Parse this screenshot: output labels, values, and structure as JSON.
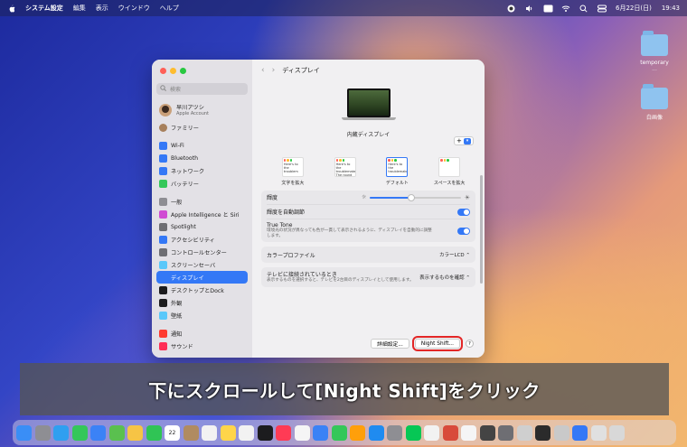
{
  "menubar": {
    "app_name": "システム設定",
    "menus": [
      "編集",
      "表示",
      "ウインドウ",
      "ヘルプ"
    ],
    "datetime": "6月22日(日)",
    "time": "19:43"
  },
  "desktop": {
    "icons": [
      {
        "label": "temporary",
        "sublabel": "..."
      },
      {
        "label": "白画像"
      }
    ]
  },
  "sidebar": {
    "search_placeholder": "検索",
    "account": {
      "name": "早川アツシ",
      "sub": "Apple Account"
    },
    "family": "ファミリー",
    "group1": [
      {
        "label": "Wi-Fi",
        "color": "#3478f6"
      },
      {
        "label": "Bluetooth",
        "color": "#3478f6"
      },
      {
        "label": "ネットワーク",
        "color": "#3478f6"
      },
      {
        "label": "バッテリー",
        "color": "#34c759"
      }
    ],
    "group2": [
      {
        "label": "一般",
        "color": "#8e8e93"
      },
      {
        "label": "Apple Intelligence と Siri",
        "color": "#d04bd3"
      },
      {
        "label": "Spotlight",
        "color": "#6e6e73"
      },
      {
        "label": "アクセシビリティ",
        "color": "#3478f6"
      },
      {
        "label": "コントロールセンター",
        "color": "#6e6e73"
      },
      {
        "label": "スクリーンセーバ",
        "color": "#5ac8fa"
      },
      {
        "label": "ディスプレイ",
        "color": "#3478f6",
        "selected": true
      },
      {
        "label": "デスクトップとDock",
        "color": "#1c1c1e"
      },
      {
        "label": "外観",
        "color": "#1c1c1e"
      },
      {
        "label": "壁紙",
        "color": "#5ac8fa"
      }
    ],
    "group3": [
      {
        "label": "通知",
        "color": "#ff3b30"
      },
      {
        "label": "サウンド",
        "color": "#ff2d55"
      }
    ]
  },
  "content": {
    "title": "ディスプレイ",
    "display_name": "内蔵ディスプレイ",
    "add_label": "+",
    "resolutions": [
      {
        "label": "文字を拡大",
        "text": "Here's to the troublem"
      },
      {
        "label": "",
        "text": "Here's to the troublemakers. The round pegs"
      },
      {
        "label": "デフォルト",
        "text": "Here's to the troublemakers",
        "selected": true
      },
      {
        "label": "スペースを拡大",
        "text": ""
      }
    ],
    "brightness_label": "輝度",
    "brightness_level": 0.45,
    "auto_brightness_label": "輝度を自動調節",
    "true_tone_label": "True Tone",
    "true_tone_desc": "環境光の状況が異なっても色が一貫して表示されるように、ディスプレイを自動的に調整します。",
    "color_profile_label": "カラープロファイル",
    "color_profile_value": "カラーLCD",
    "tv_label": "テレビに接続されているとき",
    "tv_desc": "表示するものを選択すると、テレビを2台目のディスプレイとして使用します。",
    "tv_value": "表示するものを確認",
    "advanced_button": "詳細設定...",
    "night_shift_button": "Night Shift...",
    "help": "?"
  },
  "caption": "下にスクロールして[Night Shift]をクリック",
  "dock": {
    "apps": [
      {
        "name": "finder",
        "color": "#3a8ef6"
      },
      {
        "name": "launchpad",
        "color": "#8e8e93"
      },
      {
        "name": "safari",
        "color": "#2f9ff0"
      },
      {
        "name": "messages",
        "color": "#34c759"
      },
      {
        "name": "mail",
        "color": "#3b82f6"
      },
      {
        "name": "maps",
        "color": "#5ac04f"
      },
      {
        "name": "photos",
        "color": "#f6c445"
      },
      {
        "name": "facetime",
        "color": "#30c455"
      },
      {
        "name": "calendar",
        "color": "#ffffff",
        "text": "22"
      },
      {
        "name": "contacts",
        "color": "#b08b60"
      },
      {
        "name": "reminders",
        "color": "#f2f2f2"
      },
      {
        "name": "notes",
        "color": "#ffd54a"
      },
      {
        "name": "freeform",
        "color": "#f2f2f2"
      },
      {
        "name": "tv",
        "color": "#1c1c1e"
      },
      {
        "name": "music",
        "color": "#ff3b55"
      },
      {
        "name": "news",
        "color": "#f5f5f5"
      },
      {
        "name": "keynote",
        "color": "#3a82f6"
      },
      {
        "name": "numbers",
        "color": "#34c759"
      },
      {
        "name": "pages",
        "color": "#ff9f0a"
      },
      {
        "name": "app-store",
        "color": "#1f8bf0"
      },
      {
        "name": "system-settings",
        "color": "#8e8e93"
      },
      {
        "name": "line",
        "color": "#06c755"
      },
      {
        "name": "app-a",
        "color": "#f2f2f2"
      },
      {
        "name": "app-b",
        "color": "#d84a3a"
      },
      {
        "name": "app-c",
        "color": "#f5f5f5"
      },
      {
        "name": "app-d",
        "color": "#444"
      },
      {
        "name": "app-e",
        "color": "#6e6e73"
      },
      {
        "name": "app-f",
        "color": "#cfcfcf"
      },
      {
        "name": "app-g",
        "color": "#2b2b2b"
      },
      {
        "name": "app-h",
        "color": "#c9c9c9"
      },
      {
        "name": "app-i",
        "color": "#3478f6"
      },
      {
        "name": "app-j",
        "color": "#e0e0e0"
      },
      {
        "name": "trash",
        "color": "#d8d8d8"
      }
    ]
  }
}
